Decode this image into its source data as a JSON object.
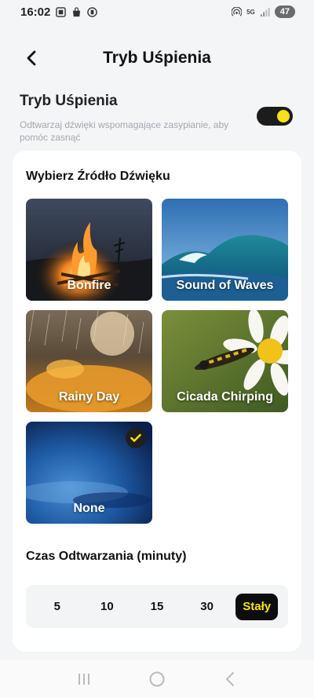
{
  "status_bar": {
    "time": "16:02",
    "network": "5G",
    "battery": "47"
  },
  "header": {
    "title": "Tryb Uśpienia",
    "back_icon": "chevron-left-icon"
  },
  "sleep_mode": {
    "title": "Tryb Uśpienia",
    "description": "Odtwarzaj dźwięki wspomagające zasypianie, aby pomóc zasnąć",
    "enabled": true,
    "toggle_color": "#f6e11c"
  },
  "sound_source": {
    "title": "Wybierz Źródło Dźwięku",
    "options": [
      {
        "label": "Bonfire",
        "selected": false
      },
      {
        "label": "Sound of Waves",
        "selected": false
      },
      {
        "label": "Rainy Day",
        "selected": false
      },
      {
        "label": "Cicada Chirping",
        "selected": false
      },
      {
        "label": "None",
        "selected": true
      }
    ]
  },
  "play_time": {
    "title": "Czas Odtwarzania (minuty)",
    "options": [
      "5",
      "10",
      "15",
      "30",
      "Stały"
    ],
    "selected": "Stały"
  },
  "nav_bar": {
    "recent_icon": "recent-apps-icon",
    "home_icon": "home-icon",
    "back_icon": "back-icon"
  },
  "colors": {
    "accent": "#f6e11c",
    "dark": "#0d0d0d"
  }
}
